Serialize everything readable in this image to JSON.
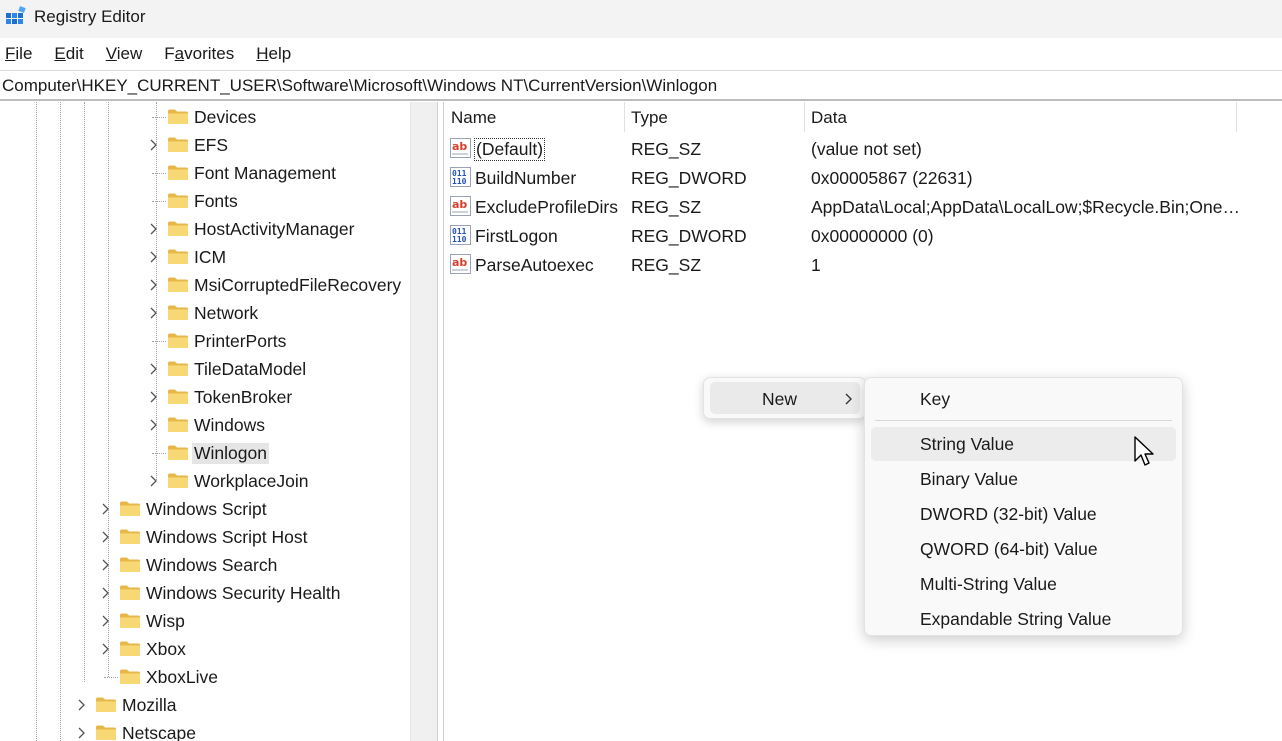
{
  "window": {
    "title": "Registry Editor",
    "icon": "registry-editor-icon"
  },
  "menubar": {
    "items": [
      {
        "label_u": "F",
        "label_rest": "ile"
      },
      {
        "label_u": "E",
        "label_rest": "dit"
      },
      {
        "label_u": "V",
        "label_rest": "iew"
      },
      {
        "label_pre": "F",
        "label_u": "a",
        "label_rest": "vorites"
      },
      {
        "label_u": "H",
        "label_rest": "elp"
      }
    ]
  },
  "address": {
    "path": "Computer\\HKEY_CURRENT_USER\\Software\\Microsoft\\Windows NT\\CurrentVersion\\Winlogon"
  },
  "tree": {
    "items": [
      {
        "label": "Devices",
        "expandable": false
      },
      {
        "label": "EFS",
        "expandable": true
      },
      {
        "label": "Font Management",
        "expandable": false
      },
      {
        "label": "Fonts",
        "expandable": false
      },
      {
        "label": "HostActivityManager",
        "expandable": true
      },
      {
        "label": "ICM",
        "expandable": true
      },
      {
        "label": "MsiCorruptedFileRecovery",
        "expandable": true
      },
      {
        "label": "Network",
        "expandable": true
      },
      {
        "label": "PrinterPorts",
        "expandable": false
      },
      {
        "label": "TileDataModel",
        "expandable": true
      },
      {
        "label": "TokenBroker",
        "expandable": true
      },
      {
        "label": "Windows",
        "expandable": true
      },
      {
        "label": "Winlogon",
        "expandable": false,
        "selected": true
      },
      {
        "label": "WorkplaceJoin",
        "expandable": true
      },
      {
        "label": "Windows Script",
        "expandable": true
      },
      {
        "label": "Windows Script Host",
        "expandable": true
      },
      {
        "label": "Windows Search",
        "expandable": true
      },
      {
        "label": "Windows Security Health",
        "expandable": true
      },
      {
        "label": "Wisp",
        "expandable": true
      },
      {
        "label": "Xbox",
        "expandable": true
      },
      {
        "label": "XboxLive",
        "expandable": false
      },
      {
        "label": "Mozilla",
        "expandable": true
      },
      {
        "label": "Netscape",
        "expandable": true
      }
    ]
  },
  "list": {
    "columns": [
      "Name",
      "Type",
      "Data"
    ],
    "rows": [
      {
        "name": "(Default)",
        "type": "REG_SZ",
        "data": "(value not set)",
        "icon": "string-value-icon"
      },
      {
        "name": "BuildNumber",
        "type": "REG_DWORD",
        "data": "0x00005867 (22631)",
        "icon": "binary-value-icon"
      },
      {
        "name": "ExcludeProfileDirs",
        "type": "REG_SZ",
        "data": "AppData\\Local;AppData\\LocalLow;$Recycle.Bin;One…",
        "icon": "string-value-icon"
      },
      {
        "name": "FirstLogon",
        "type": "REG_DWORD",
        "data": "0x00000000 (0)",
        "icon": "binary-value-icon"
      },
      {
        "name": "ParseAutoexec",
        "type": "REG_SZ",
        "data": "1",
        "icon": "string-value-icon"
      }
    ]
  },
  "context_menu": {
    "new_label": "New"
  },
  "submenu": {
    "items": [
      "Key",
      "String Value",
      "Binary Value",
      "DWORD (32-bit) Value",
      "QWORD (64-bit) Value",
      "Multi-String Value",
      "Expandable String Value"
    ],
    "hovered": "String Value"
  },
  "colors": {
    "folder": "#f8d775",
    "folder_dark": "#e6b84a",
    "selection": "#e5e5e5",
    "menu_bg": "#f9f9f9"
  }
}
